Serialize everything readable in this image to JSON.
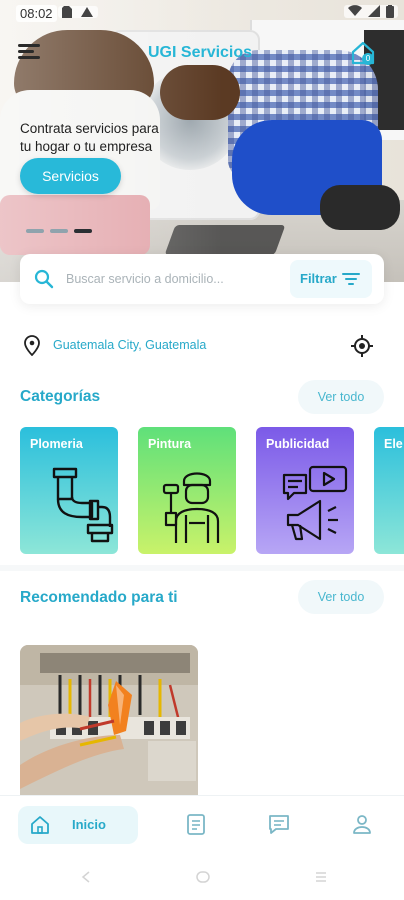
{
  "status_bar": {
    "time": "08:02"
  },
  "header": {
    "app_title": "UGI Servicios",
    "notification_count": "0"
  },
  "hero": {
    "headline": "Contrata servicios para",
    "subline": "tu hogar o tu empresa",
    "cta_label": "Servicios",
    "carousel_total": 3,
    "carousel_active_index": 2
  },
  "search": {
    "placeholder": "Buscar servicio a domicilio...",
    "filter_label": "Filtrar"
  },
  "location": {
    "text": "Guatemala City, Guatemala"
  },
  "categories": {
    "title": "Categorías",
    "see_all": "Ver todo",
    "items": [
      {
        "label": "Plomeria",
        "icon": "pipe-icon",
        "gradient": [
          "#2bbfdc",
          "#8de6d8"
        ]
      },
      {
        "label": "Pintura",
        "icon": "painter-icon",
        "gradient": [
          "#5fe07a",
          "#c9f26a"
        ]
      },
      {
        "label": "Publicidad",
        "icon": "megaphone-icon",
        "gradient": [
          "#7b5ae8",
          "#b7a6f5"
        ]
      },
      {
        "label": "Ele",
        "icon": "electric-icon",
        "gradient": [
          "#2bbfdc",
          "#8de6d8"
        ]
      }
    ]
  },
  "recommended": {
    "title": "Recomendado para ti",
    "see_all": "Ver todo"
  },
  "bottom_nav": {
    "home_label": "Inicio"
  },
  "colors": {
    "primary": "#27b6d6",
    "primary_dark": "#27a9c9",
    "chip_bg": "#f1f8fa"
  }
}
